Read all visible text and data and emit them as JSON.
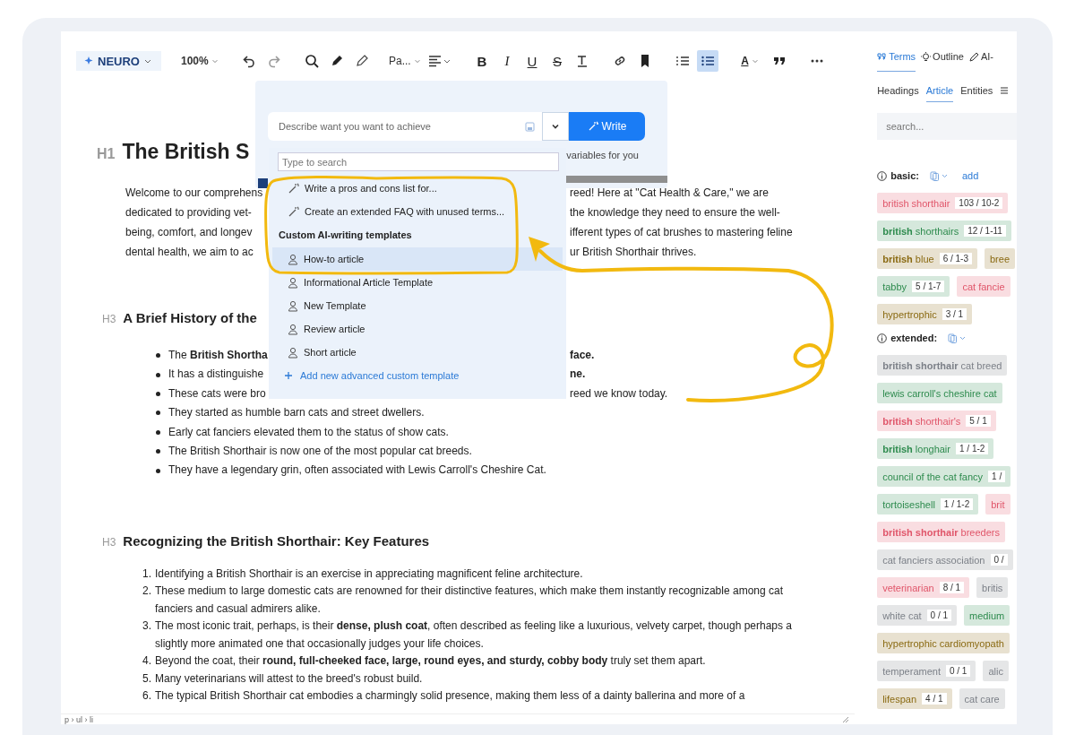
{
  "toolbar": {
    "logo": "NEURO",
    "zoom": "100%",
    "style": "Pa...",
    "bold": "B",
    "italic": "I",
    "underline": "U",
    "strike": "S",
    "text_color": "A",
    "list_buttons": [
      {
        "kind": "ordered",
        "selected": false
      },
      {
        "kind": "bullet",
        "selected": true
      }
    ]
  },
  "article": [
    {
      "kind": "heading",
      "level": "H1",
      "text": "The British S"
    },
    {
      "kind": "paragraph",
      "lines": [
        {
          "left": "Welcome to our comprehens",
          "right": "reed! Here at \"Cat Health & Care,\" we are"
        },
        {
          "left": "dedicated to providing vet-",
          "right": "the knowledge they need to ensure the well-"
        },
        {
          "left": "being, comfort, and longev",
          "right": "ifferent types of cat brushes to mastering feline"
        },
        {
          "left": "dental health, we aim to ac",
          "right": "ur British Shorthair thrives."
        }
      ]
    },
    {
      "kind": "heading",
      "level": "H3",
      "text": "A Brief History of the"
    },
    {
      "kind": "bullets",
      "items": [
        {
          "left": "The **British Shortha**",
          "right": "**face.**"
        },
        {
          "left": "It has a distinguishe",
          "right": "**ne.**"
        },
        {
          "left": "These cats were bro",
          "right": "reed we know today."
        },
        {
          "left": "They started as humble barn cats and street dwellers."
        },
        {
          "left": "Early cat fanciers elevated them to the status of show cats."
        },
        {
          "left": "The British Shorthair is now one of the most popular cat breeds."
        },
        {
          "left": "They have a legendary grin, often associated with Lewis Carroll's Cheshire Cat."
        }
      ]
    },
    {
      "kind": "heading",
      "level": "H3",
      "text": "Recognizing the British Shorthair: Key Features"
    },
    {
      "kind": "numbered",
      "items": [
        {
          "number": "1.",
          "text": "Identifying a British Shorthair is an exercise in appreciating magnificent feline architecture."
        },
        {
          "number": "2.",
          "text": "These medium to large domestic cats are renowned for their distinctive features, which make them instantly recognizable among cat fanciers and casual admirers alike."
        },
        {
          "number": "3.",
          "text": "The most iconic trait, perhaps, is their **dense, plush coat**, often described as feeling like a luxurious, velvety carpet, though perhaps a slightly more animated one that occasionally judges your life choices."
        },
        {
          "number": "4.",
          "text": "Beyond the coat, their **round, full-cheeked face, large, round eyes, and sturdy, cobby body** truly set them apart."
        },
        {
          "number": "5.",
          "text": "Many veterinarians will attest to the breed's robust build."
        },
        {
          "number": "6.",
          "text": "The typical British Shorthair cat embodies a charmingly solid presence, making them less of a dainty ballerina and more of a"
        }
      ]
    }
  ],
  "popup": {
    "prompt_placeholder": "Describe want you want to achieve",
    "write_label": "Write",
    "hint": "variables for you",
    "search_placeholder": "Type to search",
    "actions": [
      {
        "label": "Write a pros and cons list for...",
        "selected": false
      },
      {
        "label": "Create an extended FAQ with unused terms...",
        "selected": false
      }
    ],
    "section_title": "Custom AI-writing templates",
    "templates": [
      {
        "label": "How-to article",
        "selected": true
      },
      {
        "label": "Informational Article Template",
        "selected": false
      },
      {
        "label": "New Template",
        "selected": false
      },
      {
        "label": "Review article",
        "selected": false
      },
      {
        "label": "Short article",
        "selected": false
      }
    ],
    "add_link": "Add new advanced custom template"
  },
  "status_bar": {
    "path": "p › ul › li"
  },
  "panel": {
    "tabs": [
      {
        "label": "Terms",
        "selected": true
      },
      {
        "label": "Outline",
        "selected": false
      },
      {
        "label": "AI-",
        "selected": false
      }
    ],
    "subtabs": [
      {
        "label": "Headings",
        "selected": false
      },
      {
        "label": "Article",
        "selected": true
      },
      {
        "label": "Entities",
        "selected": false
      }
    ],
    "search_placeholder": "search...",
    "groups": [
      {
        "label": "basic:",
        "add": "add",
        "rows": [
          [
            {
              "label": "british shorthair",
              "count": "103 / 10-2",
              "color": "#e0566a"
            }
          ],
          [
            {
              "label": "**british** shorthairs",
              "count": "12 / 1-11",
              "color": "#2e8b4e"
            }
          ],
          [
            {
              "label": "**british** blue",
              "count": "6 / 1-3",
              "color": "#8a6a12"
            },
            {
              "label": "bree",
              "color": "#8a6a12"
            }
          ],
          [
            {
              "label": "tabby",
              "count": "5 / 1-7",
              "color": "#2e8b4e"
            },
            {
              "label": "cat fancie",
              "color": "#e0566a"
            }
          ],
          [
            {
              "label": "hypertrophic",
              "count": "3 / 1",
              "color": "#8a6a12"
            }
          ]
        ]
      },
      {
        "label": "extended:",
        "rows": [
          [
            {
              "label": "**british shorthair** cat breed",
              "color": "#7c8088"
            }
          ],
          [
            {
              "label": "lewis carroll's cheshire cat",
              "color": "#2e8b4e"
            }
          ],
          [
            {
              "label": "**british** shorthair's",
              "count": "5 / 1",
              "color": "#e0566a"
            }
          ],
          [
            {
              "label": "**british** longhair",
              "count": "1 / 1-2",
              "color": "#2e8b4e"
            }
          ],
          [
            {
              "label": "council of the cat fancy",
              "count": "1 /",
              "color": "#2e8b4e"
            }
          ],
          [
            {
              "label": "tortoiseshell",
              "count": "1 / 1-2",
              "color": "#2e8b4e"
            },
            {
              "label": "brit",
              "color": "#e0566a"
            }
          ],
          [
            {
              "label": "**british shorthair** breeders",
              "color": "#e0566a"
            }
          ],
          [
            {
              "label": "cat fanciers association",
              "count": "0 /",
              "color": "#7c8088"
            }
          ],
          [
            {
              "label": "veterinarian",
              "count": "8 / 1",
              "color": "#e0566a"
            },
            {
              "label": "britis",
              "color": "#7c8088"
            }
          ],
          [
            {
              "label": "white cat",
              "count": "0 / 1",
              "color": "#7c8088"
            },
            {
              "label": "medium",
              "color": "#2e8b4e"
            }
          ],
          [
            {
              "label": "hypertrophic cardiomyopath",
              "color": "#8a6a12"
            }
          ],
          [
            {
              "label": "temperament",
              "count": "0 / 1",
              "color": "#7c8088"
            },
            {
              "label": "alic",
              "color": "#7c8088"
            }
          ],
          [
            {
              "label": "lifespan",
              "count": "4 / 1",
              "color": "#8a6a12"
            },
            {
              "label": "cat care",
              "color": "#7c8088"
            }
          ]
        ]
      }
    ]
  }
}
